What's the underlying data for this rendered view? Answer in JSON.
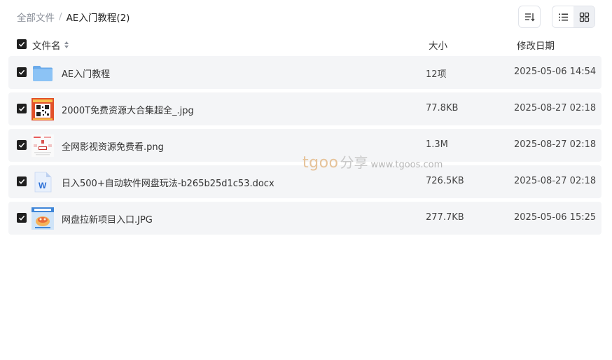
{
  "breadcrumb": {
    "root": "全部文件",
    "separator": "/",
    "current": "AE入门教程(2)"
  },
  "toolbar": {
    "sort_icon": "sort-list-icon",
    "view_list_icon": "list-view-icon",
    "view_grid_icon": "grid-view-icon",
    "active_view": "grid"
  },
  "columns": {
    "name": "文件名",
    "size": "大小",
    "date": "修改日期"
  },
  "files": [
    {
      "name": "AE入门教程",
      "size": "12项",
      "date": "2025-05-06 14:54",
      "type": "folder",
      "checked": true
    },
    {
      "name": "2000T免费资源大合集超全_.jpg",
      "size": "77.8KB",
      "date": "2025-08-27 02:18",
      "type": "image-qr",
      "checked": true
    },
    {
      "name": "全网影视资源免费看.png",
      "size": "1.3M",
      "date": "2025-08-27 02:18",
      "type": "image-poster",
      "checked": true
    },
    {
      "name": "日入500+自动软件网盘玩法-b265b25d1c53.docx",
      "size": "726.5KB",
      "date": "2025-08-27 02:18",
      "type": "word-doc",
      "checked": true
    },
    {
      "name": "网盘拉新项目入口.JPG",
      "size": "277.7KB",
      "date": "2025-05-06 15:25",
      "type": "image-promo",
      "checked": true
    }
  ],
  "watermark": {
    "brand": "tgoo",
    "cn": "分享",
    "url": "www.tgoos.com"
  },
  "colors": {
    "row_bg": "#f4f5f7",
    "checkbox": "#1f1f1f",
    "folder": "#7db8f0",
    "word": "#2b6fd6",
    "watermark_brand": "#e6c39a"
  }
}
